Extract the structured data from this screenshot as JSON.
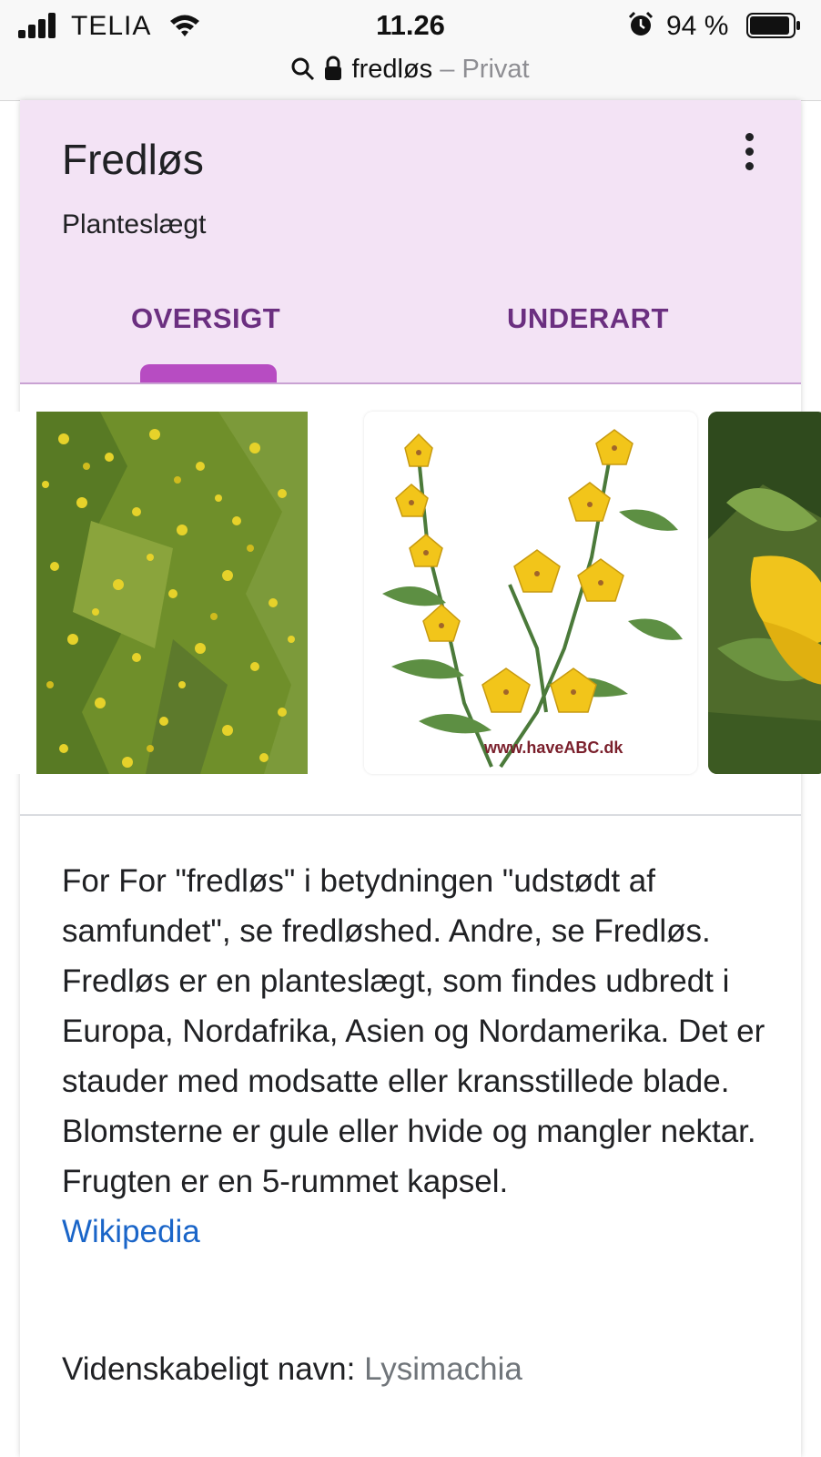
{
  "status_bar": {
    "carrier": "TELIA",
    "time": "11.26",
    "battery_percent": "94 %",
    "battery_level": 0.94,
    "icons": [
      "signal-icon",
      "wifi-icon",
      "alarm-icon",
      "battery-icon"
    ]
  },
  "url_bar": {
    "url": "fredløs",
    "separator": "–",
    "mode": "Privat",
    "icons": [
      "search-icon",
      "lock-icon"
    ]
  },
  "card": {
    "title": "Fredløs",
    "subtitle": "Planteslægt",
    "menu_icon": "more-vert-icon",
    "tabs": [
      {
        "label": "OVERSIGT",
        "selected": true
      },
      {
        "label": "UNDERART",
        "selected": false
      }
    ],
    "images": [
      {
        "name": "ground-cover-flowers"
      },
      {
        "name": "yellow-loosestrife-drawing",
        "watermark": "www.haveABC.dk"
      },
      {
        "name": "yellow-flower-closeup"
      }
    ],
    "description": "For For \"fredløs\" i betydningen \"udstødt af samfundet\", se fredløshed. Andre, se Fredløs. Fredløs er en planteslægt, som findes udbredt i Europa, Nordafrika, Asien og Nordamerika. Det er stauder med modsatte eller kransstillede blade. Blomsterne er gule eller hvide og mangler nektar. Frugten er en 5-rummet kapsel.",
    "source_link": "Wikipedia",
    "scientific_name_label": "Videnskabeligt navn:",
    "scientific_name_value": "Lysimachia"
  },
  "colors": {
    "header_bg": "#f3e3f5",
    "tab_text": "#6b2f80",
    "tab_indicator": "#b74cc2",
    "link": "#1a65c8"
  }
}
